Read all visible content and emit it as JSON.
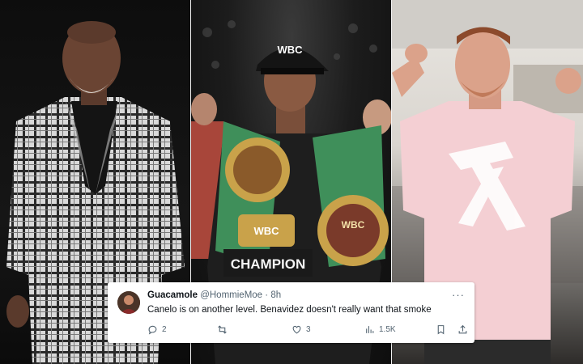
{
  "tweet": {
    "display_name": "Guacamole",
    "handle": "@HommieMoe",
    "separator": "·",
    "time": "8h",
    "text": "Canelo is on another level. Benavidez doesn't really want that smoke",
    "more_icon": "more-horizontal-icon",
    "actions": [
      {
        "icon": "reply-icon",
        "count": "2"
      },
      {
        "icon": "retweet-icon",
        "count": ""
      },
      {
        "icon": "like-icon",
        "count": "3"
      },
      {
        "icon": "views-icon",
        "count": "1.5K"
      },
      {
        "icon": "bookmark-icon",
        "count": ""
      },
      {
        "icon": "share-icon",
        "count": ""
      }
    ]
  },
  "photos": {
    "center_cap_text": "WBC",
    "belt_center_text": "WBC",
    "belt_left_text": "WBC",
    "belt_banner_text": "CHAMPION"
  },
  "colors": {
    "tweet_bg": "#ffffff",
    "text_primary": "#0f1419",
    "text_secondary": "#536471",
    "belt_green": "#3f8f5a",
    "belt_gold": "#c9a24a",
    "shirt_pink": "#f4cfd3"
  }
}
